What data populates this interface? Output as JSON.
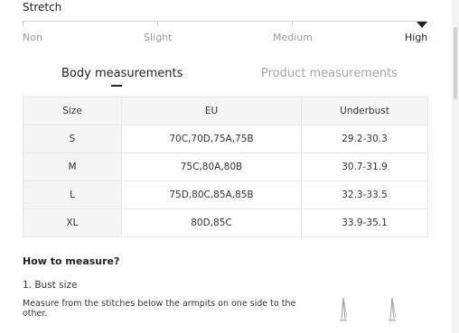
{
  "stretch": {
    "title": "Stretch",
    "levels": [
      "Non",
      "Slight",
      "Medium",
      "High"
    ],
    "selected": "High"
  },
  "tabs": [
    {
      "label": "Body measurements",
      "active": true
    },
    {
      "label": "Product measurements",
      "active": false
    }
  ],
  "table": {
    "headers": [
      "Size",
      "EU",
      "Underbust"
    ],
    "rows": [
      [
        "S",
        "70C,70D,75A,75B",
        "29.2-30.3"
      ],
      [
        "M",
        "75C,80A,80B",
        "30.7-31.9"
      ],
      [
        "L",
        "75D,80C,85A,85B",
        "32.3-33.5"
      ],
      [
        "XL",
        "80D,85C",
        "33.9-35.1"
      ]
    ]
  },
  "how_to": {
    "title": "How to measure?",
    "step1_title": "1. Bust size",
    "step1_desc": "Measure from the stitches below the armpits on one side to the other."
  },
  "colors": {
    "accent": "#222222",
    "muted": "#a6a6a6",
    "header_bg": "#f5f5f5",
    "border": "#e7e7e7"
  }
}
